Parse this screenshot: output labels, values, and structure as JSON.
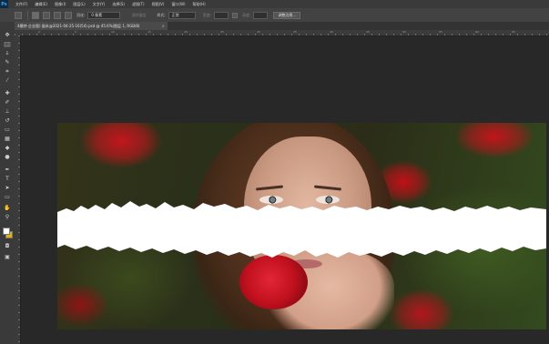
{
  "app": {
    "logo": "Ps"
  },
  "menu": [
    "文件(F)",
    "编辑(E)",
    "图像(I)",
    "图层(L)",
    "文字(Y)",
    "选择(S)",
    "滤镜(T)",
    "视图(V)",
    "窗口(W)",
    "帮助(H)"
  ],
  "options": {
    "feather_label": "羽化:",
    "feather_value": "0 像素",
    "antialias_label": "消除锯齿",
    "style_label": "样式:",
    "style_value": "正常",
    "width_label": "宽度:",
    "height_label": "高度:",
    "refine_button": "调整边缘..."
  },
  "document": {
    "tab_title": "4模特-企业版) 副本@2021-04-25-16(54).psd @ 45.6%(图层 1, RGB/8)",
    "close_glyph": "×"
  },
  "ruler": {
    "top_marks": [
      "0",
      "5",
      "10",
      "15",
      "20",
      "25",
      "30",
      "35",
      "40",
      "45",
      "50",
      "55",
      "60",
      "65"
    ]
  },
  "tools": [
    {
      "name": "move-tool",
      "glyph": "✥"
    },
    {
      "name": "marquee-tool",
      "glyph": "⬚"
    },
    {
      "name": "lasso-tool",
      "glyph": "ↆ"
    },
    {
      "name": "quick-select-tool",
      "glyph": "✎"
    },
    {
      "name": "crop-tool",
      "glyph": "⌗"
    },
    {
      "name": "eyedropper-tool",
      "glyph": "⁄"
    },
    {
      "name": "healing-tool",
      "glyph": "✚"
    },
    {
      "name": "brush-tool",
      "glyph": "✐"
    },
    {
      "name": "clone-stamp-tool",
      "glyph": "⊥"
    },
    {
      "name": "history-brush-tool",
      "glyph": "↺"
    },
    {
      "name": "eraser-tool",
      "glyph": "▭"
    },
    {
      "name": "gradient-tool",
      "glyph": "▦"
    },
    {
      "name": "blur-tool",
      "glyph": "◆"
    },
    {
      "name": "dodge-tool",
      "glyph": "●"
    },
    {
      "name": "pen-tool",
      "glyph": "✒"
    },
    {
      "name": "type-tool",
      "glyph": "T"
    },
    {
      "name": "path-select-tool",
      "glyph": "➤"
    },
    {
      "name": "shape-tool",
      "glyph": "▭"
    },
    {
      "name": "hand-tool",
      "glyph": "✋"
    },
    {
      "name": "zoom-tool",
      "glyph": "⚲"
    }
  ],
  "colors": {
    "foreground": "#ffffff",
    "background": "#e8b000"
  }
}
